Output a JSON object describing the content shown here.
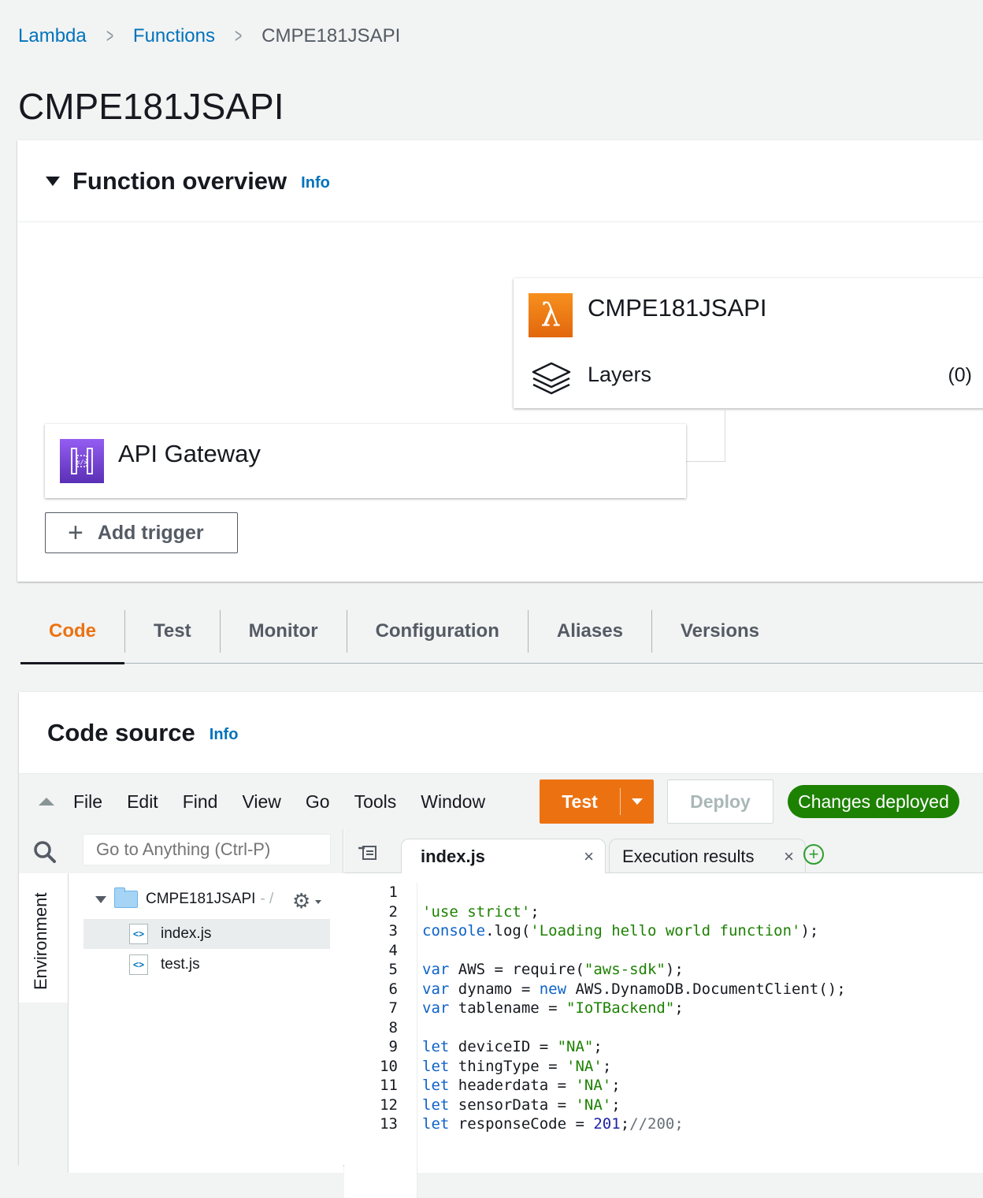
{
  "breadcrumb": {
    "items": [
      "Lambda",
      "Functions"
    ],
    "current": "CMPE181JSAPI"
  },
  "page_title": "CMPE181JSAPI",
  "function_overview": {
    "title": "Function overview",
    "info_label": "Info",
    "function_name": "CMPE181JSAPI",
    "layers_label": "Layers",
    "layers_count": "(0)",
    "trigger_name": "API Gateway",
    "add_trigger_label": "Add trigger"
  },
  "tabs": [
    {
      "label": "Code",
      "active": true
    },
    {
      "label": "Test",
      "active": false
    },
    {
      "label": "Monitor",
      "active": false
    },
    {
      "label": "Configuration",
      "active": false
    },
    {
      "label": "Aliases",
      "active": false
    },
    {
      "label": "Versions",
      "active": false
    }
  ],
  "code_source": {
    "title": "Code source",
    "info_label": "Info",
    "menu": [
      "File",
      "Edit",
      "Find",
      "View",
      "Go",
      "Tools",
      "Window"
    ],
    "test_button": "Test",
    "deploy_button": "Deploy",
    "status": "Changes deployed",
    "goto_placeholder": "Go to Anything (Ctrl-P)",
    "environment_label": "Environment",
    "folder_name": "CMPE181JSAPI",
    "folder_suffix": "- /",
    "files": [
      "index.js",
      "test.js"
    ],
    "selected_file": "index.js",
    "editor_tabs": [
      "index.js",
      "Execution results"
    ],
    "line_numbers": [
      "1",
      "2",
      "3",
      "4",
      "5",
      "6",
      "7",
      "8",
      "9",
      "10",
      "11",
      "12",
      "13"
    ]
  },
  "colors": {
    "link": "#0073bb",
    "accent": "#ec7211",
    "success": "#1d8102",
    "lambda_icon": "#e2670d",
    "apigw_icon": "#5a30b5"
  },
  "icons": [
    "caret-down-icon",
    "lambda-icon",
    "layers-icon",
    "api-gateway-icon",
    "plus-icon",
    "caret-up-icon",
    "search-icon",
    "folder-icon",
    "gear-icon",
    "file-icon",
    "tabs-menu-icon",
    "close-icon",
    "add-tab-icon"
  ]
}
